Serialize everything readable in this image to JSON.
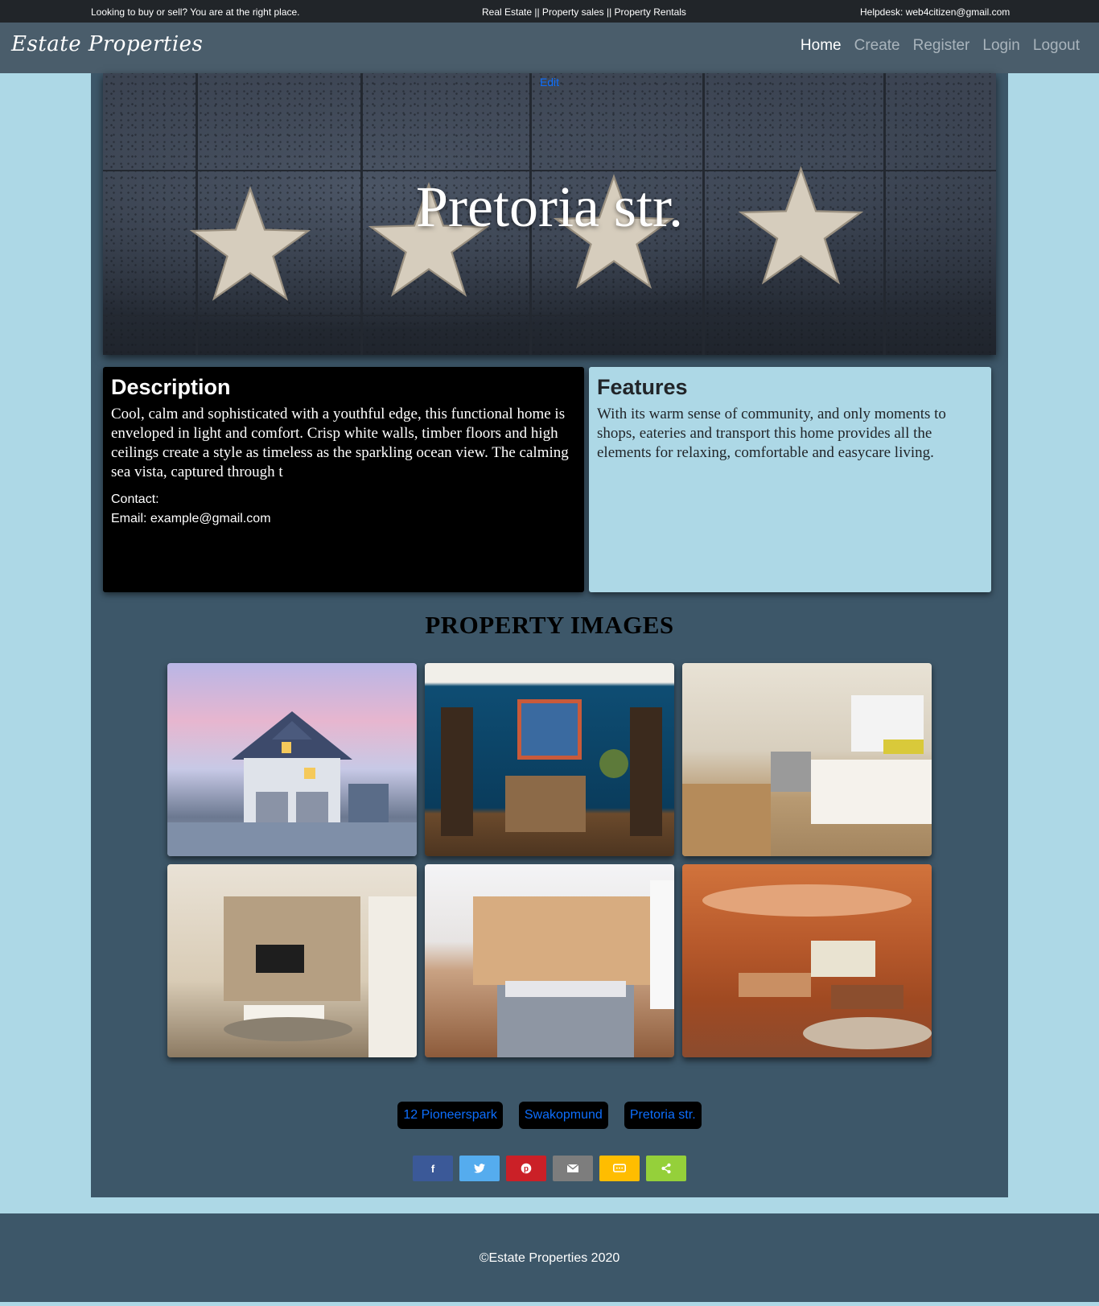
{
  "topbar": {
    "left": "Looking to buy or sell? You are at the right place.",
    "center": "Real Estate || Property sales || Property Rentals",
    "right": "Helpdesk: web4citizen@gmail.com"
  },
  "navbar": {
    "brand": "Estate Properties",
    "links": [
      {
        "label": "Home",
        "active": true
      },
      {
        "label": "Create",
        "active": false
      },
      {
        "label": "Register",
        "active": false
      },
      {
        "label": "Login",
        "active": false
      },
      {
        "label": "Logout",
        "active": false
      }
    ]
  },
  "hero": {
    "edit_label": "Edit",
    "title": "Pretoria str."
  },
  "description": {
    "title": "Description",
    "text": "Cool, calm and sophisticated with a youthful edge, this functional home is enveloped in light and comfort. Crisp white walls, timber floors and high ceilings create a style as timeless as the sparkling ocean view. The calming sea vista, captured through t",
    "contact_label": "Contact:",
    "email_line": "Email: example@gmail.com"
  },
  "features": {
    "title": "Features",
    "text": "With its warm sense of community, and only moments to shops, eateries and transport this home provides all the elements for relaxing, comfortable and easycare living."
  },
  "images_heading": "PROPERTY IMAGES",
  "photos": [
    {
      "name": "house-exterior-photo"
    },
    {
      "name": "blue-living-room-photo"
    },
    {
      "name": "kitchen-photo"
    },
    {
      "name": "tv-lounge-photo"
    },
    {
      "name": "bedroom-photo"
    },
    {
      "name": "billiard-room-photo"
    }
  ],
  "property_links": [
    "12 Pioneerspark",
    "Swakopmund",
    "Pretoria str."
  ],
  "share_buttons": [
    {
      "icon": "facebook-icon",
      "glyph": "f",
      "color": "#3b5998"
    },
    {
      "icon": "twitter-icon",
      "glyph": "🐦",
      "color": "#55acee"
    },
    {
      "icon": "pinterest-icon",
      "glyph": "P",
      "color": "#cb2027"
    },
    {
      "icon": "email-icon",
      "glyph": "✉",
      "color": "#7d7d7d"
    },
    {
      "icon": "sms-icon",
      "glyph": "SMS",
      "color": "#ffbd00"
    },
    {
      "icon": "share-icon",
      "glyph": "<",
      "color": "#95d03a"
    }
  ],
  "footer": {
    "copyright": "©Estate Properties 2020"
  }
}
